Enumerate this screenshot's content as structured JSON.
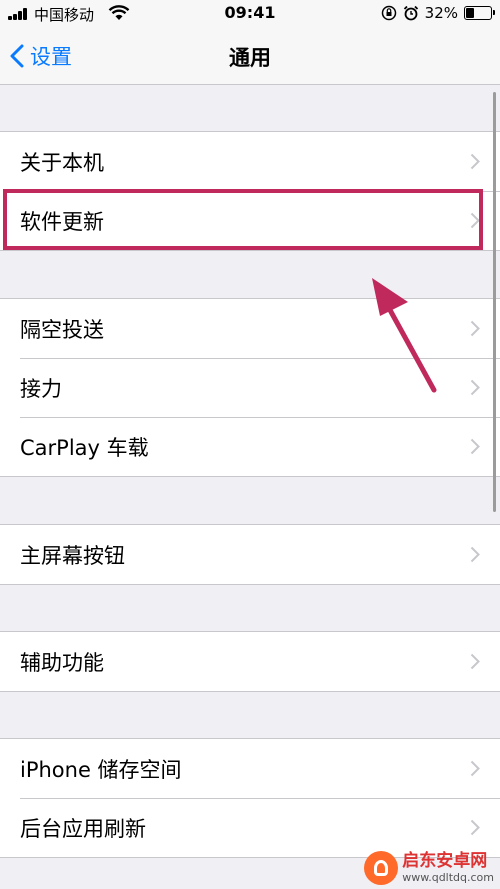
{
  "status_bar": {
    "carrier": "中国移动",
    "time": "09:41",
    "battery_text": "32%",
    "battery_level": 0.32,
    "icons": [
      "signal-icon",
      "wifi-icon",
      "orientation-lock-icon",
      "alarm-icon",
      "battery-icon"
    ]
  },
  "nav": {
    "back_label": "设置",
    "title": "通用"
  },
  "groups": [
    {
      "items": [
        {
          "label": "关于本机"
        },
        {
          "label": "软件更新"
        }
      ]
    },
    {
      "items": [
        {
          "label": "隔空投送"
        },
        {
          "label": "接力"
        },
        {
          "label": "CarPlay 车载"
        }
      ]
    },
    {
      "items": [
        {
          "label": "主屏幕按钮"
        }
      ]
    },
    {
      "items": [
        {
          "label": "辅助功能"
        }
      ]
    },
    {
      "items": [
        {
          "label": "iPhone 储存空间"
        },
        {
          "label": "后台应用刷新"
        }
      ]
    }
  ],
  "annotation": {
    "highlighted_item": "软件更新",
    "color": "#c0295c"
  },
  "watermark": {
    "name": "启东安卓网",
    "url": "www.qdltdq.com"
  },
  "colors": {
    "accent": "#0a7aff",
    "background": "#efeff4",
    "separator": "#c8c7cc",
    "chevron": "#c7c7cc"
  }
}
